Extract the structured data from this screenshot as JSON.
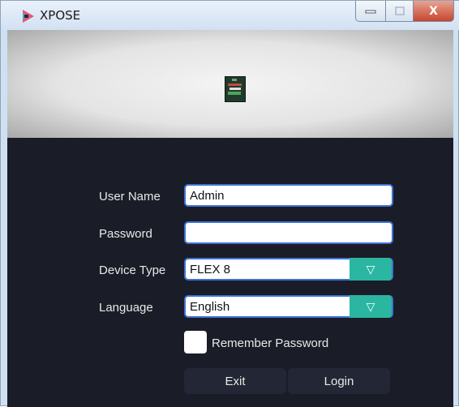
{
  "window": {
    "title": "XPOSE",
    "close_glyph": "X",
    "icons": [
      "app-icon",
      "minimize-icon",
      "maximize-icon",
      "close-icon"
    ]
  },
  "banner": {
    "logo_icon": "device-logo-icon"
  },
  "form": {
    "username": {
      "label": "User Name",
      "value": "Admin"
    },
    "password": {
      "label": "Password",
      "value": ""
    },
    "device_type": {
      "label": "Device Type",
      "value": "FLEX 8",
      "arrow": "▽"
    },
    "language": {
      "label": "Language",
      "value": "English",
      "arrow": "▽"
    },
    "remember": {
      "label": "Remember Password",
      "checked": false
    }
  },
  "actions": {
    "exit_label": "Exit",
    "login_label": "Login"
  },
  "colors": {
    "background": "#1a1d28",
    "accent": "#2ab6a0",
    "input_border": "#3c73d6",
    "button_bg": "#232735"
  }
}
